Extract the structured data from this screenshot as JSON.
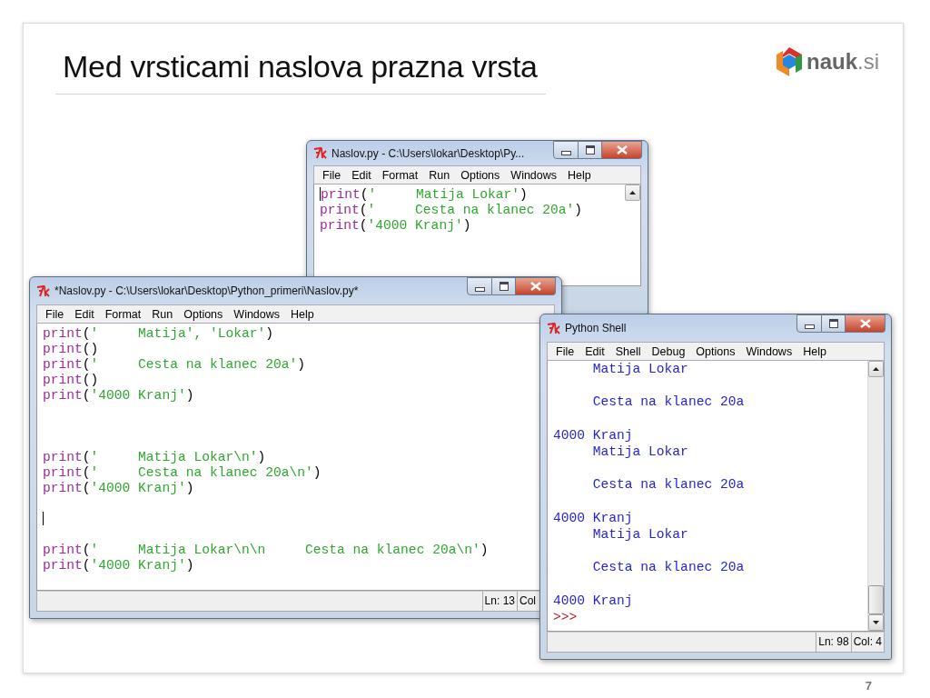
{
  "slide": {
    "title": "Med vrsticami naslova prazna vrsta",
    "logo": "**nauk**.si",
    "page_number": "7"
  },
  "windows": [
    {
      "kind": "editor",
      "title": "Naslov.py - C:\\Users\\lokar\\Desktop\\Py...",
      "menu": [
        "File",
        "Edit",
        "Format",
        "Run",
        "Options",
        "Windows",
        "Help"
      ],
      "lines": [
        {
          "kind": "code",
          "cursor": true,
          "tokens": [
            {
              "kind": "builtin",
              "text": "print"
            },
            {
              "kind": "punct",
              "text": "("
            },
            {
              "kind": "string",
              "text": "'     Matija Lokar'"
            },
            {
              "kind": "punct",
              "text": ")"
            }
          ]
        },
        {
          "kind": "code",
          "cursor": false,
          "tokens": [
            {
              "kind": "builtin",
              "text": "print"
            },
            {
              "kind": "punct",
              "text": "("
            },
            {
              "kind": "string",
              "text": "'     Cesta na klanec 20a'"
            },
            {
              "kind": "punct",
              "text": ")"
            }
          ]
        },
        {
          "kind": "code",
          "cursor": false,
          "tokens": [
            {
              "kind": "builtin",
              "text": "print"
            },
            {
              "kind": "punct",
              "text": "("
            },
            {
              "kind": "string",
              "text": "'4000 Kranj'"
            },
            {
              "kind": "punct",
              "text": ")"
            }
          ]
        }
      ]
    },
    {
      "kind": "editor",
      "title": "*Naslov.py - C:\\Users\\lokar\\Desktop\\Python_primeri\\Naslov.py*",
      "menu": [
        "File",
        "Edit",
        "Format",
        "Run",
        "Options",
        "Windows",
        "Help"
      ],
      "status": [
        "Ln: 13",
        "Col"
      ],
      "lines": [
        {
          "kind": "code",
          "cursor": false,
          "tokens": [
            {
              "kind": "builtin",
              "text": "print"
            },
            {
              "kind": "punct",
              "text": "("
            },
            {
              "kind": "string",
              "text": "'     Matija', 'Lokar'"
            },
            {
              "kind": "punct",
              "text": ")"
            }
          ]
        },
        {
          "kind": "code",
          "cursor": false,
          "tokens": [
            {
              "kind": "builtin",
              "text": "print"
            },
            {
              "kind": "punct",
              "text": "()"
            }
          ]
        },
        {
          "kind": "code",
          "cursor": false,
          "tokens": [
            {
              "kind": "builtin",
              "text": "print"
            },
            {
              "kind": "punct",
              "text": "("
            },
            {
              "kind": "string",
              "text": "'     Cesta na klanec 20a'"
            },
            {
              "kind": "punct",
              "text": ")"
            }
          ]
        },
        {
          "kind": "code",
          "cursor": false,
          "tokens": [
            {
              "kind": "builtin",
              "text": "print"
            },
            {
              "kind": "punct",
              "text": "()"
            }
          ]
        },
        {
          "kind": "code",
          "cursor": false,
          "tokens": [
            {
              "kind": "builtin",
              "text": "print"
            },
            {
              "kind": "punct",
              "text": "("
            },
            {
              "kind": "string",
              "text": "'4000 Kranj'"
            },
            {
              "kind": "punct",
              "text": ")"
            }
          ]
        },
        {
          "kind": "blank",
          "cursor": false
        },
        {
          "kind": "blank",
          "cursor": false
        },
        {
          "kind": "blank",
          "cursor": false
        },
        {
          "kind": "code",
          "cursor": false,
          "tokens": [
            {
              "kind": "builtin",
              "text": "print"
            },
            {
              "kind": "punct",
              "text": "("
            },
            {
              "kind": "string",
              "text": "'     Matija Lokar\\n'"
            },
            {
              "kind": "punct",
              "text": ")"
            }
          ]
        },
        {
          "kind": "code",
          "cursor": false,
          "tokens": [
            {
              "kind": "builtin",
              "text": "print"
            },
            {
              "kind": "punct",
              "text": "("
            },
            {
              "kind": "string",
              "text": "'     Cesta na klanec 20a\\n'"
            },
            {
              "kind": "punct",
              "text": ")"
            }
          ]
        },
        {
          "kind": "code",
          "cursor": false,
          "tokens": [
            {
              "kind": "builtin",
              "text": "print"
            },
            {
              "kind": "punct",
              "text": "("
            },
            {
              "kind": "string",
              "text": "'4000 Kranj'"
            },
            {
              "kind": "punct",
              "text": ")"
            }
          ]
        },
        {
          "kind": "blank",
          "cursor": false
        },
        {
          "kind": "blank",
          "cursor": true
        },
        {
          "kind": "blank",
          "cursor": false
        },
        {
          "kind": "code",
          "cursor": false,
          "tokens": [
            {
              "kind": "builtin",
              "text": "print"
            },
            {
              "kind": "punct",
              "text": "("
            },
            {
              "kind": "string",
              "text": "'     Matija Lokar\\n\\n     Cesta na klanec 20a\\n'"
            },
            {
              "kind": "punct",
              "text": ")"
            }
          ]
        },
        {
          "kind": "code",
          "cursor": false,
          "tokens": [
            {
              "kind": "builtin",
              "text": "print"
            },
            {
              "kind": "punct",
              "text": "("
            },
            {
              "kind": "string",
              "text": "'4000 Kranj'"
            },
            {
              "kind": "punct",
              "text": ")"
            }
          ]
        }
      ]
    },
    {
      "kind": "shell",
      "title": "Python Shell",
      "menu": [
        "File",
        "Edit",
        "Shell",
        "Debug",
        "Options",
        "Windows",
        "Help"
      ],
      "status": [
        "Ln: 98",
        "Col: 4"
      ],
      "lines": [
        {
          "kind": "code",
          "cursor": false,
          "tokens": [
            {
              "kind": "output",
              "text": "     Matija Lokar"
            }
          ]
        },
        {
          "kind": "blank",
          "cursor": false
        },
        {
          "kind": "code",
          "cursor": false,
          "tokens": [
            {
              "kind": "output",
              "text": "     Cesta na klanec 20a"
            }
          ]
        },
        {
          "kind": "blank",
          "cursor": false
        },
        {
          "kind": "code",
          "cursor": false,
          "tokens": [
            {
              "kind": "output",
              "text": "4000 Kranj"
            }
          ]
        },
        {
          "kind": "code",
          "cursor": false,
          "tokens": [
            {
              "kind": "output",
              "text": "     Matija Lokar"
            }
          ]
        },
        {
          "kind": "blank",
          "cursor": false
        },
        {
          "kind": "code",
          "cursor": false,
          "tokens": [
            {
              "kind": "output",
              "text": "     Cesta na klanec 20a"
            }
          ]
        },
        {
          "kind": "blank",
          "cursor": false
        },
        {
          "kind": "code",
          "cursor": false,
          "tokens": [
            {
              "kind": "output",
              "text": "4000 Kranj"
            }
          ]
        },
        {
          "kind": "code",
          "cursor": false,
          "tokens": [
            {
              "kind": "output",
              "text": "     Matija Lokar"
            }
          ]
        },
        {
          "kind": "blank",
          "cursor": false
        },
        {
          "kind": "code",
          "cursor": false,
          "tokens": [
            {
              "kind": "output",
              "text": "     Cesta na klanec 20a"
            }
          ]
        },
        {
          "kind": "blank",
          "cursor": false
        },
        {
          "kind": "code",
          "cursor": false,
          "tokens": [
            {
              "kind": "output",
              "text": "4000 Kranj"
            }
          ]
        },
        {
          "kind": "code",
          "cursor": false,
          "tokens": [
            {
              "kind": "prompt",
              "text": ">>>"
            }
          ]
        }
      ]
    }
  ]
}
